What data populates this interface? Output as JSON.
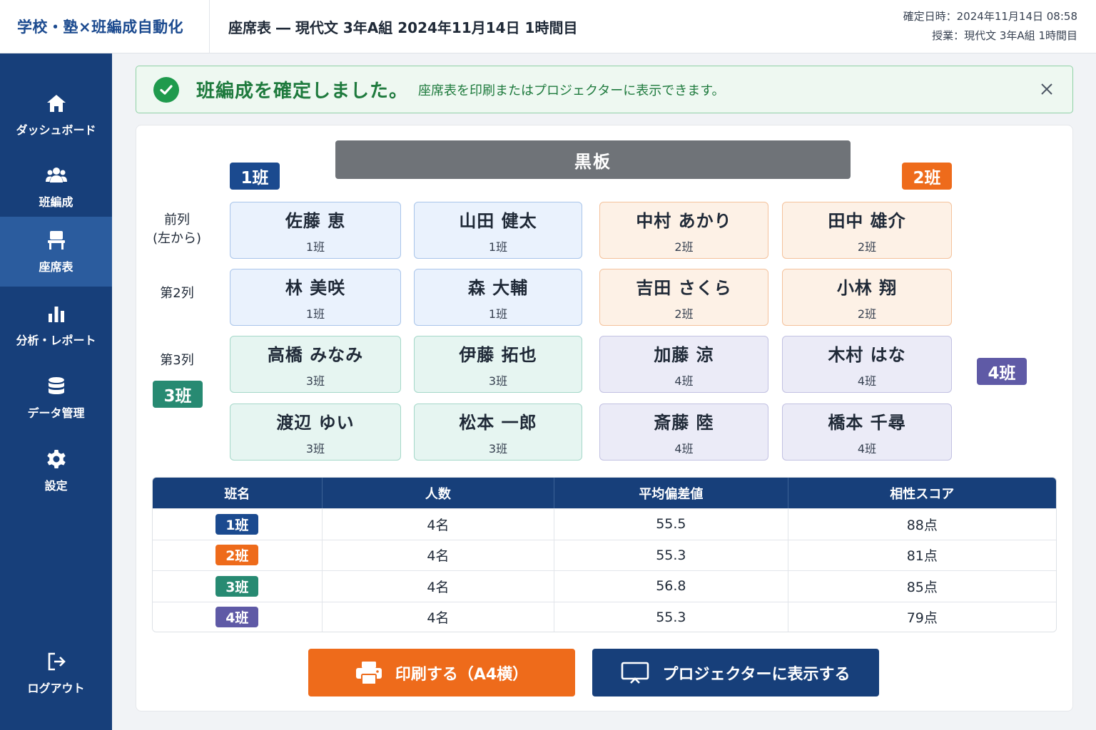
{
  "header": {
    "brand": "学校・塾×班編成自動化",
    "title": "座席表 ― 現代文 3年A組 2024年11月14日 1時間目",
    "confirmed": "確定日時：2024年11月14日 08:58",
    "lesson": "授業：現代文 3年A組 1時間目"
  },
  "sidebar": {
    "items": [
      {
        "label": "ダッシュボード",
        "icon": "home-icon"
      },
      {
        "label": "班編成",
        "icon": "users-icon"
      },
      {
        "label": "座席表",
        "icon": "chair-icon"
      },
      {
        "label": "分析・レポート",
        "icon": "bar-chart-icon"
      },
      {
        "label": "データ管理",
        "icon": "database-icon"
      },
      {
        "label": "設定",
        "icon": "gear-icon"
      }
    ],
    "logout": "ログアウト"
  },
  "alert": {
    "title": "班編成を確定しました。",
    "message": "座席表を印刷またはプロジェクターに表示できます。"
  },
  "seating": {
    "blackboard": "黒板",
    "group_badges": [
      "1班",
      "2班",
      "3班",
      "4班"
    ],
    "row_labels": {
      "front": "前列",
      "front_sub": "(左から)",
      "second": "第2列",
      "third": "第3列"
    },
    "seats": [
      {
        "name": "佐藤 恵",
        "group": "1班"
      },
      {
        "name": "山田 健太",
        "group": "1班"
      },
      {
        "name": "中村 あかり",
        "group": "2班"
      },
      {
        "name": "田中 雄介",
        "group": "2班"
      },
      {
        "name": "林 美咲",
        "group": "1班"
      },
      {
        "name": "森 大輔",
        "group": "1班"
      },
      {
        "name": "吉田 さくら",
        "group": "2班"
      },
      {
        "name": "小林 翔",
        "group": "2班"
      },
      {
        "name": "高橋 みなみ",
        "group": "3班"
      },
      {
        "name": "伊藤 拓也",
        "group": "3班"
      },
      {
        "name": "加藤 涼",
        "group": "4班"
      },
      {
        "name": "木村 はな",
        "group": "4班"
      },
      {
        "name": "渡辺 ゆい",
        "group": "3班"
      },
      {
        "name": "松本 一郎",
        "group": "3班"
      },
      {
        "name": "斎藤 陸",
        "group": "4班"
      },
      {
        "name": "橋本 千尋",
        "group": "4班"
      }
    ]
  },
  "summary": {
    "headers": [
      "班名",
      "人数",
      "平均偏差値",
      "相性スコア"
    ],
    "rows": [
      {
        "group": "1班",
        "count": "4名",
        "avg": "55.5",
        "score": "88点"
      },
      {
        "group": "2班",
        "count": "4名",
        "avg": "55.3",
        "score": "81点"
      },
      {
        "group": "3班",
        "count": "4名",
        "avg": "56.8",
        "score": "85点"
      },
      {
        "group": "4班",
        "count": "4名",
        "avg": "55.3",
        "score": "79点"
      }
    ]
  },
  "actions": {
    "print": "印刷する（A4横）",
    "projector": "プロジェクターに表示する"
  },
  "colors": {
    "navy": "#173f7a",
    "orange": "#ee6b1b",
    "teal": "#278a72",
    "purple": "#5f5aa6",
    "success": "#1f9a4d"
  }
}
